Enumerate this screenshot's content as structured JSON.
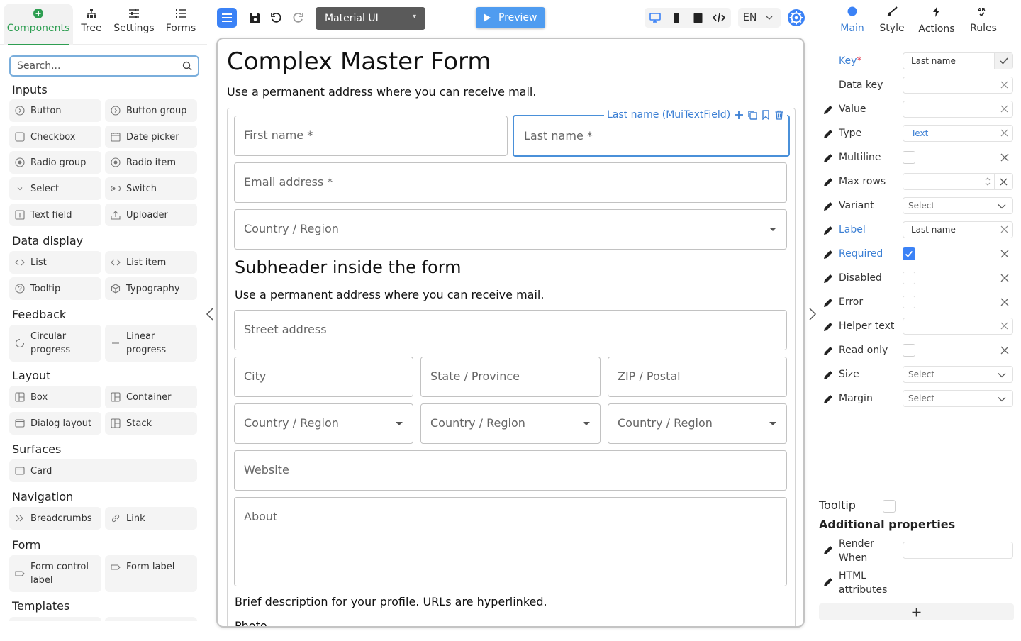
{
  "left_tabs": [
    {
      "label": "Components",
      "icon": "plus-circle-icon"
    },
    {
      "label": "Tree",
      "icon": "tree-icon"
    },
    {
      "label": "Settings",
      "icon": "sliders-icon"
    },
    {
      "label": "Forms",
      "icon": "list-icon"
    }
  ],
  "search": {
    "placeholder": "Search..."
  },
  "sections": [
    "Inputs",
    "Data display",
    "Feedback",
    "Layout",
    "Surfaces",
    "Navigation",
    "Form",
    "Templates"
  ],
  "components": {
    "inputs": [
      "Button",
      "Button group",
      "Checkbox",
      "Date picker",
      "Radio group",
      "Radio item",
      "Select",
      "Switch",
      "Text field",
      "Uploader"
    ],
    "data_display": [
      "List",
      "List item",
      "Tooltip",
      "Typography"
    ],
    "feedback": [
      "Circular progress",
      "Linear progress"
    ],
    "layout": [
      "Box",
      "Container",
      "Dialog layout",
      "Stack"
    ],
    "surfaces": [
      "Card"
    ],
    "navigation": [
      "Breadcrumbs",
      "Link"
    ],
    "form": [
      "Form control label",
      "Form label"
    ]
  },
  "toolbar": {
    "library": "Material UI",
    "preview": "Preview",
    "language": "EN"
  },
  "form": {
    "title": "Complex Master Form",
    "description": "Use a permanent address where you can receive mail.",
    "first_name": "First name *",
    "last_name": "Last name *",
    "email": "Email address *",
    "country": "Country / Region",
    "subheader": "Subheader inside the form",
    "subdescription": "Use a permanent address where you can receive mail.",
    "street": "Street address",
    "city": "City",
    "state": "State / Province",
    "zip": "ZIP / Postal",
    "country2": "Country / Region",
    "country3": "Country / Region",
    "country4": "Country / Region",
    "website": "Website",
    "about": "About",
    "helper": "Brief description for your profile. URLs are hyperlinked.",
    "photo": "Photo",
    "selected_label": "Last name (MuiTextField)"
  },
  "right_tabs": [
    {
      "label": "Main",
      "icon": "dot-icon"
    },
    {
      "label": "Style",
      "icon": "brush-icon"
    },
    {
      "label": "Actions",
      "icon": "bolt-icon"
    },
    {
      "label": "Rules",
      "icon": "rules-icon"
    }
  ],
  "props": {
    "key": {
      "name": "Key",
      "value": "Last name"
    },
    "data_key": {
      "name": "Data key",
      "value": ""
    },
    "value": {
      "name": "Value",
      "value": ""
    },
    "type": {
      "name": "Type",
      "value": "Text"
    },
    "multiline": {
      "name": "Multiline"
    },
    "max_rows": {
      "name": "Max rows",
      "value": ""
    },
    "variant": {
      "name": "Variant",
      "value": "Select"
    },
    "label": {
      "name": "Label",
      "value": "Last name"
    },
    "required": {
      "name": "Required",
      "checked": true
    },
    "disabled": {
      "name": "Disabled"
    },
    "error": {
      "name": "Error"
    },
    "helper_text": {
      "name": "Helper text",
      "value": ""
    },
    "read_only": {
      "name": "Read only"
    },
    "size": {
      "name": "Size",
      "value": "Select"
    },
    "margin": {
      "name": "Margin",
      "value": "Select"
    }
  },
  "tooltip_label": "Tooltip",
  "additional_title": "Additional properties",
  "render_when": "Render When",
  "html_attrs": "HTML attributes",
  "colors": {
    "accent_blue": "#3b82f6",
    "active_green": "#2e9e52",
    "link_blue": "#3b7fd4",
    "required_red": "#e0364c"
  }
}
